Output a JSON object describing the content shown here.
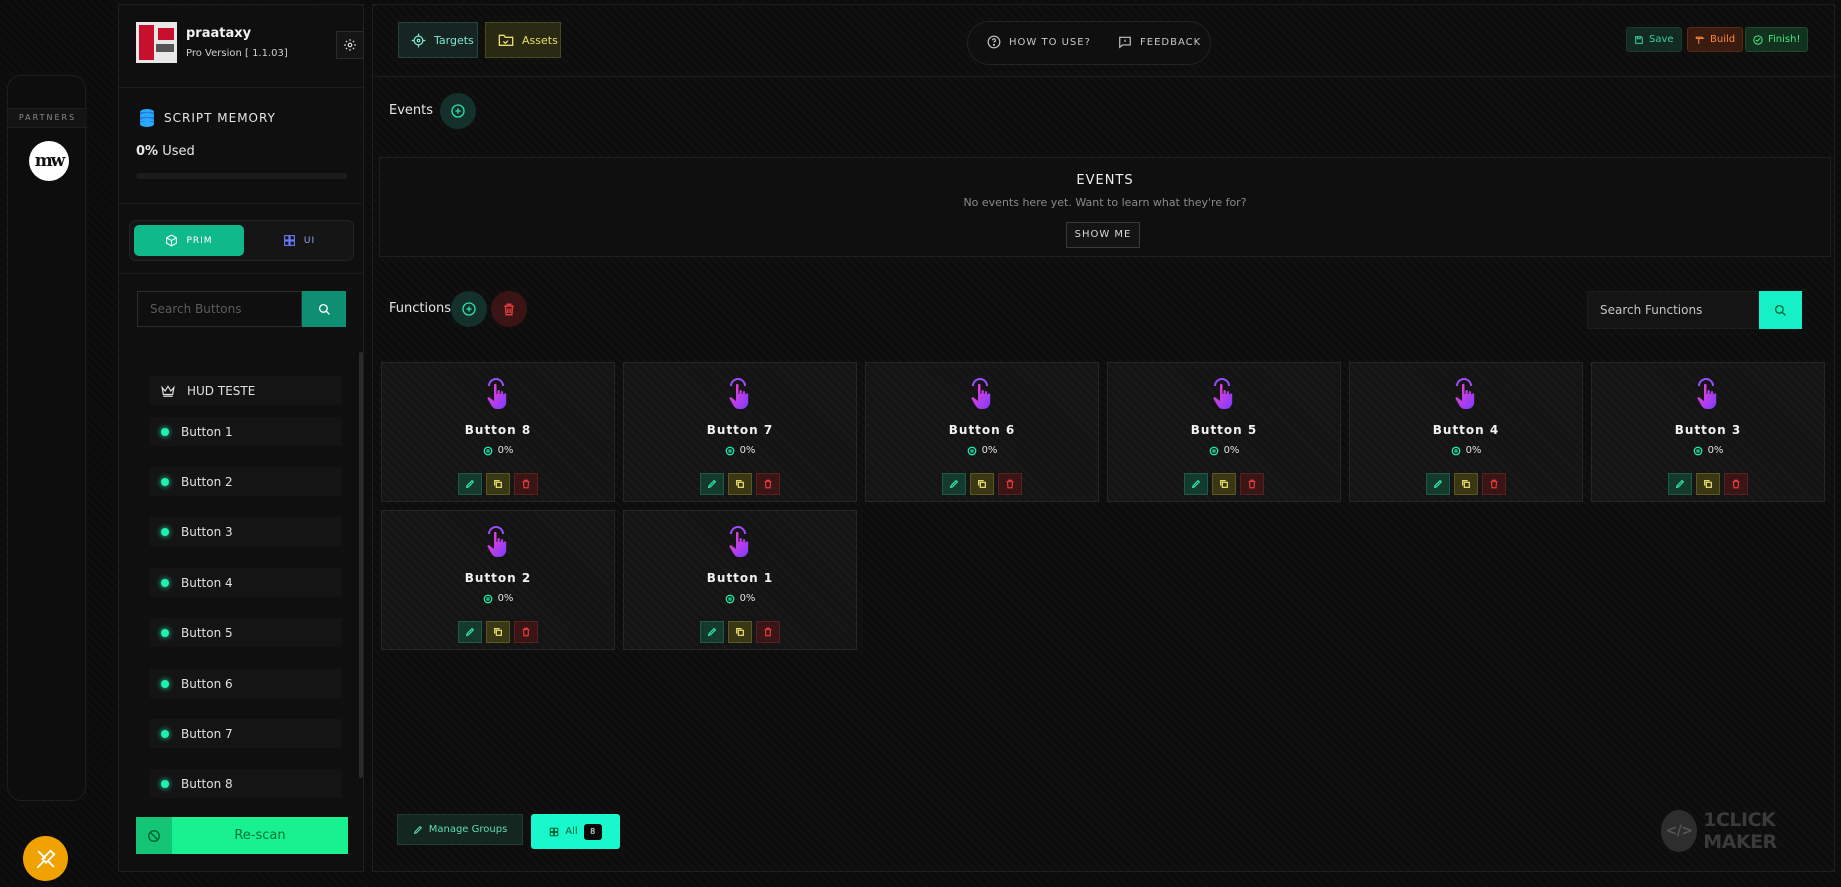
{
  "partners": {
    "title": "PARTNERS",
    "logo_text": "mw"
  },
  "profile": {
    "username": "praataxy",
    "version": "Pro Version [ 1.1.03]"
  },
  "memory": {
    "title": "SCRIPT MEMORY",
    "percent": "0%",
    "used_label": "Used",
    "usage_fraction": 0
  },
  "mode_tabs": [
    {
      "label": "PRIM",
      "active": true,
      "icon": "cube-icon"
    },
    {
      "label": "UI",
      "active": false,
      "icon": "grid-icon"
    }
  ],
  "sidebar_search": {
    "placeholder": "Search Buttons"
  },
  "sidebar_items": [
    {
      "label": "HUD TESTE",
      "icon": "crown-icon"
    },
    {
      "label": "Button 1"
    },
    {
      "label": "Button 2"
    },
    {
      "label": "Button 3"
    },
    {
      "label": "Button 4"
    },
    {
      "label": "Button 5"
    },
    {
      "label": "Button 6"
    },
    {
      "label": "Button 7"
    },
    {
      "label": "Button 8"
    }
  ],
  "rescan": {
    "label": "Re-scan"
  },
  "topbar": {
    "targets_label": "Targets",
    "assets_label": "Assets",
    "help_label": "HOW TO USE?",
    "feedback_label": "FEEDBACK",
    "save_label": "Save",
    "build_label": "Build",
    "finish_label": "Finish!"
  },
  "events": {
    "section_label": "Events",
    "box_title": "EVENTS",
    "box_subtitle": "No events here yet. Want to learn what they're for?",
    "show_me_label": "SHOW ME"
  },
  "functions": {
    "section_label": "Functions",
    "search_placeholder": "Search Functions",
    "cards": [
      {
        "name": "Button 8",
        "percent": "0%"
      },
      {
        "name": "Button 7",
        "percent": "0%"
      },
      {
        "name": "Button 6",
        "percent": "0%"
      },
      {
        "name": "Button 5",
        "percent": "0%"
      },
      {
        "name": "Button 4",
        "percent": "0%"
      },
      {
        "name": "Button 3",
        "percent": "0%"
      },
      {
        "name": "Button 2",
        "percent": "0%"
      },
      {
        "name": "Button 1",
        "percent": "0%"
      }
    ]
  },
  "footer": {
    "manage_groups_label": "Manage Groups",
    "all_label": "All",
    "all_count": "8"
  },
  "watermark": {
    "text": "1CLICK MAKER"
  },
  "colors": {
    "accent": "#19f7cd",
    "green": "#19f08f",
    "card_bg": "#141414",
    "danger": "#e03b3b"
  }
}
